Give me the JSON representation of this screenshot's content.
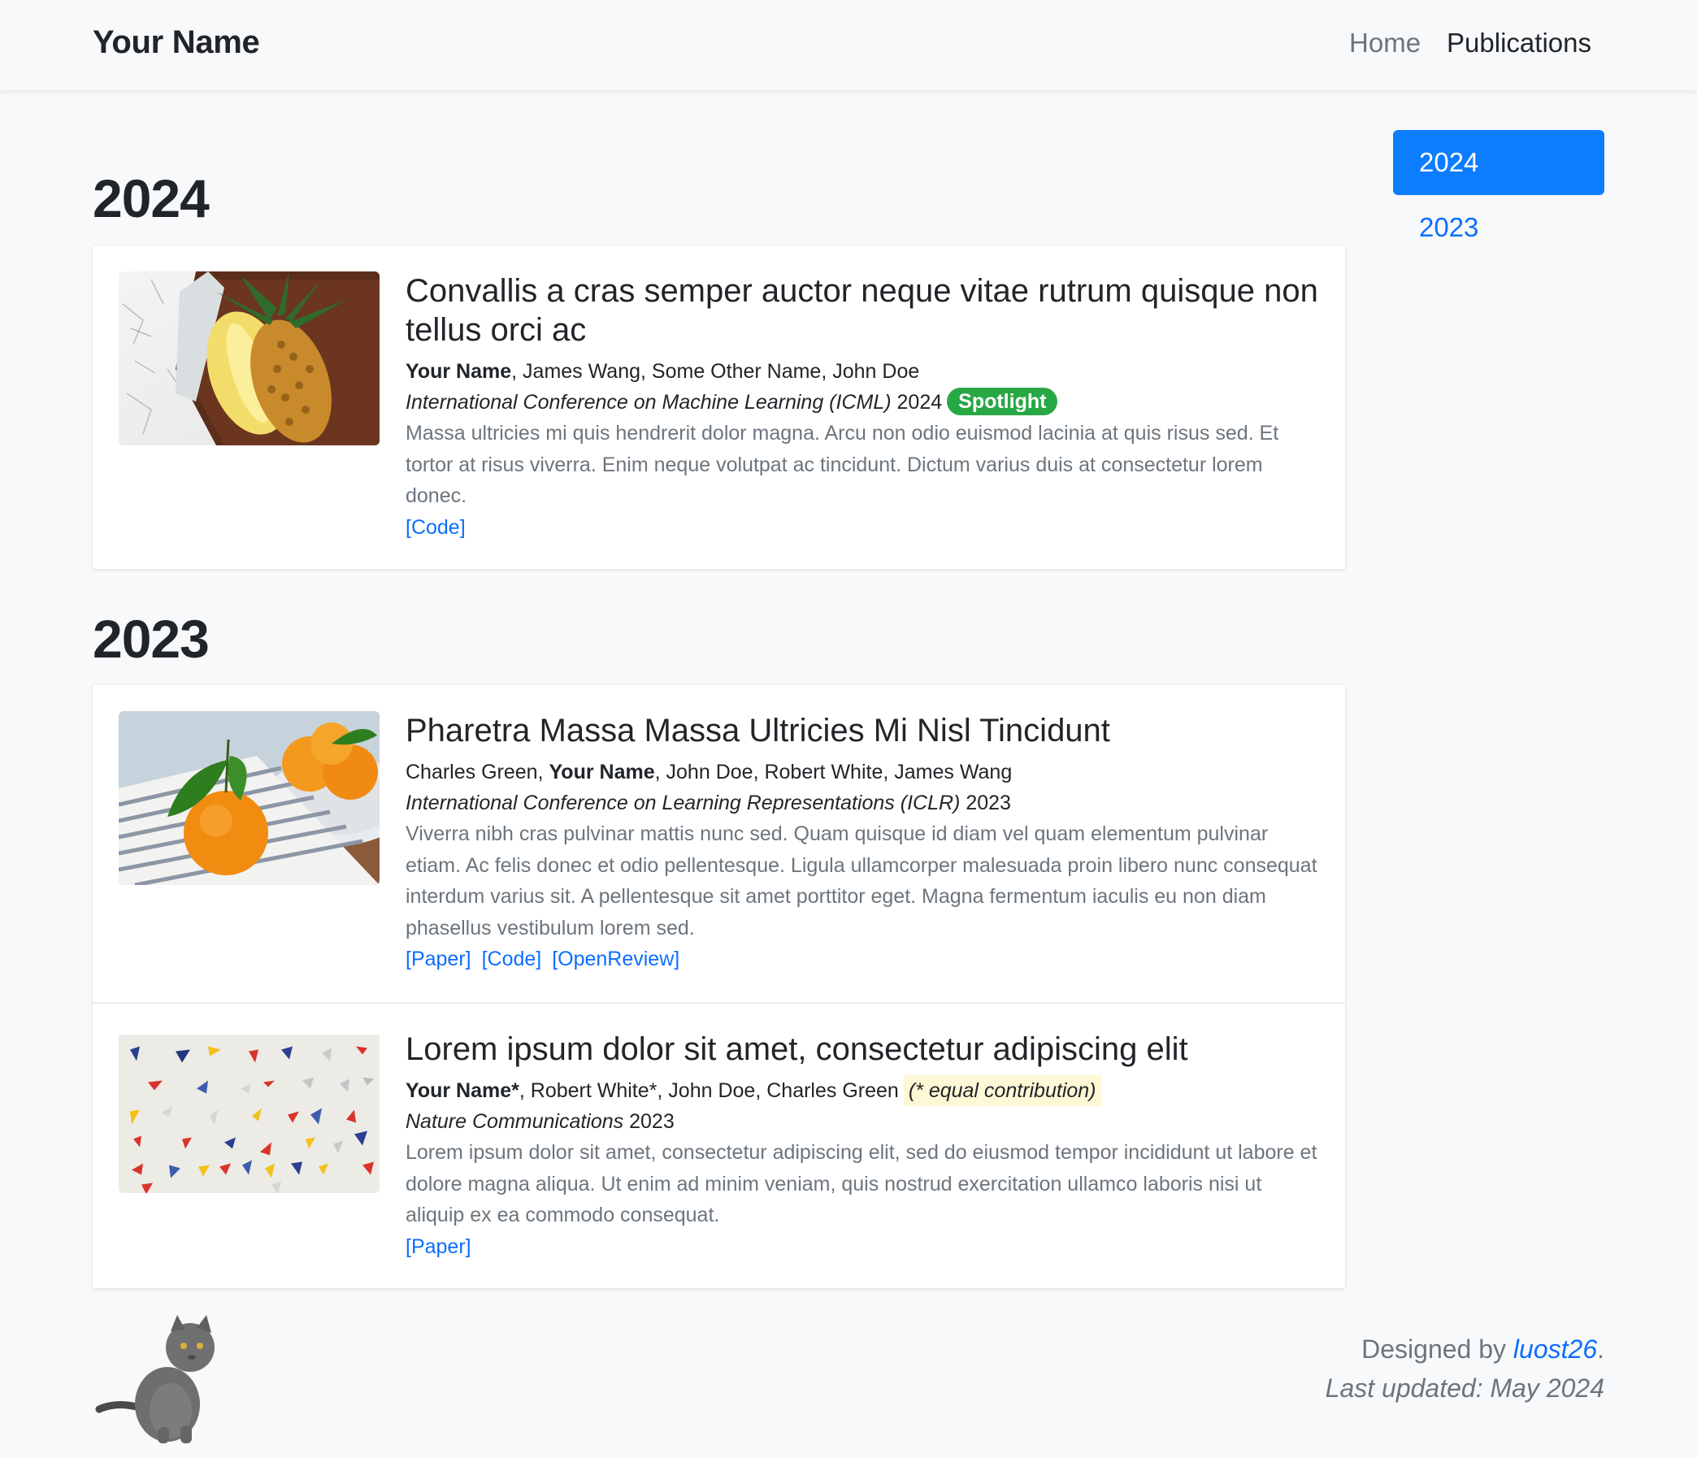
{
  "navbar": {
    "brand": "Your Name",
    "links": [
      {
        "label": "Home",
        "active": false
      },
      {
        "label": "Publications",
        "active": true
      }
    ]
  },
  "sections": [
    {
      "year": "2024",
      "publications": [
        {
          "thumbnail": "pineapple-image",
          "title": "Convallis a cras semper auctor neque vitae rutrum quisque non tellus orci ac",
          "authors": [
            {
              "name": "Your Name",
              "bold": true
            },
            {
              "name": "James Wang"
            },
            {
              "name": "Some Other Name"
            },
            {
              "name": "John Doe"
            }
          ],
          "venue_italic": "International Conference on Machine Learning (ICML)",
          "venue_year": "2024",
          "badge": "Spotlight",
          "abstract": "Massa ultricies mi quis hendrerit dolor magna. Arcu non odio euismod lacinia at quis risus sed. Et tortor at risus viverra. Enim neque volutpat ac tincidunt. Dictum varius duis at consectetur lorem donec.",
          "links": [
            "[Code]"
          ]
        }
      ]
    },
    {
      "year": "2023",
      "publications": [
        {
          "thumbnail": "tangerine-image",
          "title": "Pharetra Massa Massa Ultricies Mi Nisl Tincidunt",
          "authors": [
            {
              "name": "Charles Green"
            },
            {
              "name": "Your Name",
              "bold": true
            },
            {
              "name": "John Doe"
            },
            {
              "name": "Robert White"
            },
            {
              "name": "James Wang"
            }
          ],
          "venue_italic": "International Conference on Learning Representations (ICLR)",
          "venue_year": "2023",
          "abstract": "Viverra nibh cras pulvinar mattis nunc sed. Quam quisque id diam vel quam elementum pulvinar etiam. Ac felis donec et odio pellentesque. Ligula ullamcorper malesuada proin libero nunc consequat interdum varius sit. A pellentesque sit amet porttitor eget. Magna fermentum iaculis eu non diam phasellus vestibulum lorem sed.",
          "links": [
            "[Paper]",
            "[Code]",
            "[OpenReview]"
          ]
        },
        {
          "thumbnail": "triangles-image",
          "title": "Lorem ipsum dolor sit amet, consectetur adipiscing elit",
          "authors": [
            {
              "name": "Your Name*",
              "bold": true
            },
            {
              "name": "Robert White*"
            },
            {
              "name": "John Doe"
            },
            {
              "name": "Charles Green"
            }
          ],
          "equal_note": "(* equal contribution)",
          "venue_italic": "Nature Communications",
          "venue_year": "2023",
          "abstract": "Lorem ipsum dolor sit amet, consectetur adipiscing elit, sed do eiusmod tempor incididunt ut labore et dolore magna aliqua. Ut enim ad minim veniam, quis nostrud exercitation ullamco laboris nisi ut aliquip ex ea commodo consequat.",
          "links": [
            "[Paper]"
          ]
        }
      ]
    }
  ],
  "side_nav": [
    {
      "label": "2024",
      "active": true
    },
    {
      "label": "2023",
      "active": false
    }
  ],
  "footer": {
    "designed_prefix": "Designed by ",
    "designer": "luost26",
    "designed_suffix": ".",
    "last_updated": "Last updated: May 2024",
    "mascot": "cat-image"
  },
  "colors": {
    "accent": "#0d6efd",
    "active_pill": "#0d7dff",
    "badge": "#28a745",
    "muted": "#6c757d",
    "highlight": "#fff8d6"
  }
}
